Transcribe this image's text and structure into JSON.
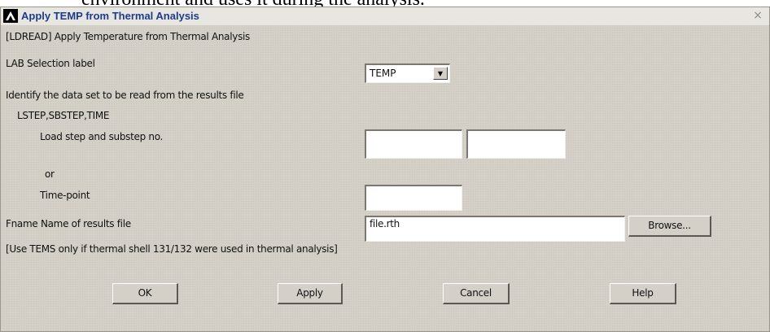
{
  "background_caption": "environment and uses it during the analysis.",
  "window": {
    "title": "Apply TEMP from Thermal Analysis",
    "close_glyph": "×"
  },
  "header_text": "[LDREAD]  Apply Temperature from Thermal Analysis",
  "lab": {
    "label": "LAB   Selection label",
    "selected": "TEMP",
    "arrow_glyph": "▼"
  },
  "identify_text": "Identify the data set to be read from the results file",
  "lstep_text": "LSTEP,SBSTEP,TIME",
  "load_step": {
    "label": "Load step and substep no.",
    "step_value": "",
    "substep_value": ""
  },
  "or_text": "or",
  "time_point": {
    "label": "Time-point",
    "value": ""
  },
  "fname": {
    "label": "Fname  Name of results file",
    "value": "file.rth",
    "browse_label": "Browse..."
  },
  "note_text": "[Use TEMS only if thermal shell 131/132 were used in thermal analysis]",
  "buttons": {
    "ok": "OK",
    "apply": "Apply",
    "cancel": "Cancel",
    "help": "Help"
  }
}
